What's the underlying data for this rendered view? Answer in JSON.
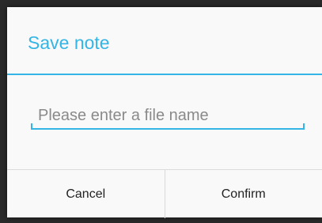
{
  "dialog": {
    "title": "Save note",
    "accent_color": "#33b5e5",
    "filename_input": {
      "value": "",
      "placeholder": "Please enter a file name"
    },
    "buttons": {
      "cancel_label": "Cancel",
      "confirm_label": "Confirm"
    }
  }
}
